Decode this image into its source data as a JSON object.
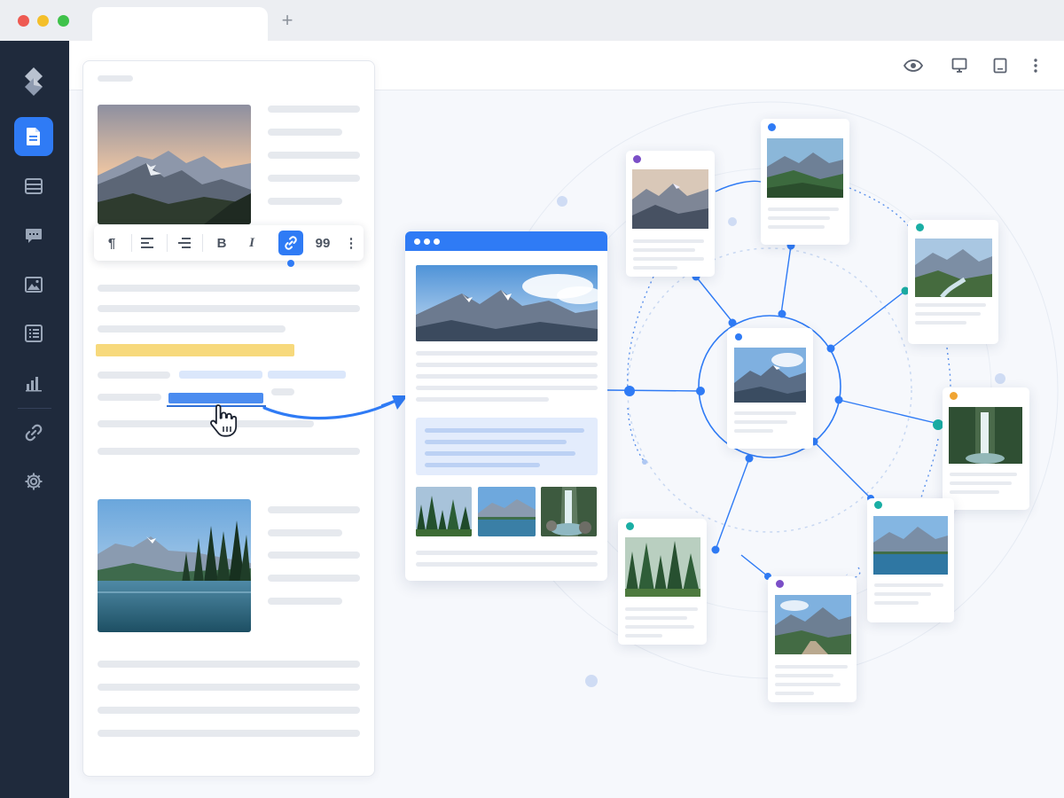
{
  "window": {
    "title_bar": {
      "new_tab_label": "+"
    },
    "traffic_lights": [
      "close",
      "minimize",
      "maximize"
    ]
  },
  "sidebar": {
    "logo_icon": "diamond-logo-icon",
    "items": [
      {
        "id": "documents",
        "icon": "document-icon",
        "active": true
      },
      {
        "id": "layout",
        "icon": "layout-icon",
        "active": false
      },
      {
        "id": "comments",
        "icon": "comment-icon",
        "active": false
      },
      {
        "id": "media",
        "icon": "image-icon",
        "active": false
      },
      {
        "id": "list",
        "icon": "list-icon",
        "active": false
      },
      {
        "id": "analytics",
        "icon": "bar-chart-icon",
        "active": false
      },
      {
        "id": "links",
        "icon": "link-icon",
        "active": false
      },
      {
        "id": "settings",
        "icon": "gear-icon",
        "active": false
      }
    ]
  },
  "toolbar": {
    "buttons": [
      "eye-icon",
      "desktop-icon",
      "tablet-icon",
      "more-vertical-icon"
    ]
  },
  "format_toolbar": {
    "paragraph": "¶",
    "bold": "B",
    "italic": "I",
    "quote": "99",
    "more": "⋮",
    "active_button": "link"
  },
  "colors": {
    "accent": "#2f7bf5",
    "sidebar": "#1f2a3c",
    "highlight": "#f7d97c",
    "node_dot_purple": "#7b4fc7",
    "node_dot_teal": "#1aaea4",
    "node_dot_orange": "#f0a432",
    "node_dot_blue": "#2f7bf5"
  }
}
